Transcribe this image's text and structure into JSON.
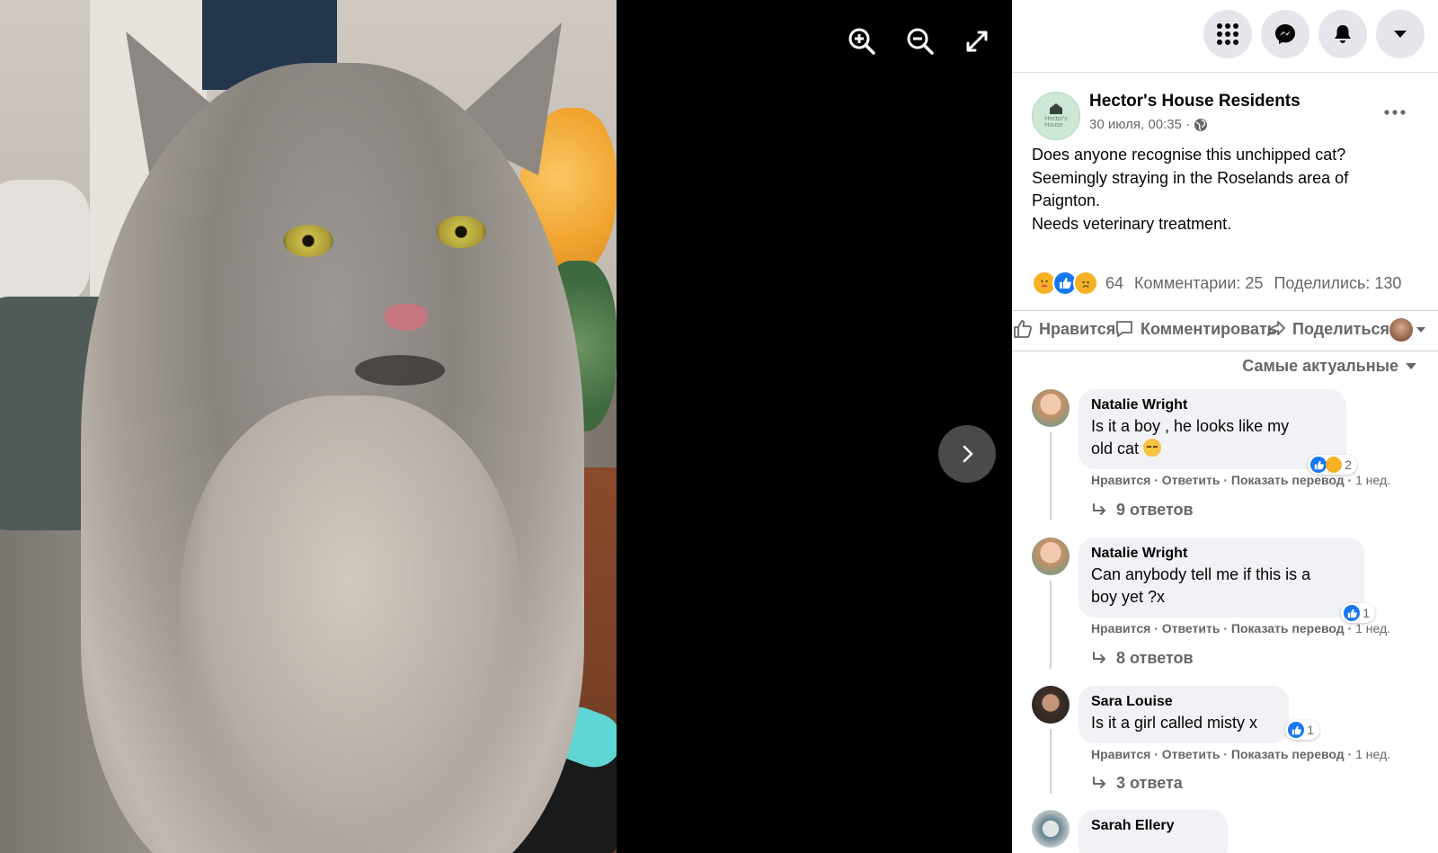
{
  "viewer": {
    "icons": {
      "zoom_in": "zoom-in-icon",
      "zoom_out": "zoom-out-icon",
      "fullscreen": "fullscreen-icon",
      "next": "chevron-right-icon"
    }
  },
  "topbar": {
    "icons": [
      "grid-menu-icon",
      "messenger-icon",
      "bell-icon",
      "caret-down-icon"
    ]
  },
  "post": {
    "author": "Hector's House Residents",
    "date": "30 июля, 00:35 ·",
    "privacy_icon": "globe-icon",
    "text_lines": [
      "Does anyone recognise this unchipped cat?",
      "Seemingly straying in the Roselands area of",
      "Paignton.",
      "Needs veterinary treatment."
    ],
    "reactions": {
      "count": "64",
      "types": [
        "care",
        "like",
        "sad"
      ]
    },
    "comments_count": "Комментарии: 25",
    "shares_count": "Поделились: 130",
    "actions": {
      "like": "Нравится",
      "comment": "Комментировать",
      "share": "Поделиться"
    },
    "sort_label": "Самые актуальные"
  },
  "comments": [
    {
      "author": "Natalie Wright",
      "text_lines": [
        "Is it a boy , he looks like my",
        "old cat"
      ],
      "emoji": "pensive-face",
      "reaction_count": "2",
      "like": "Нравится",
      "reply": "Ответить",
      "translate": "Показать перевод",
      "time": "1 нед.",
      "replies": "9 ответов"
    },
    {
      "author": "Natalie Wright",
      "text_lines": [
        "Can anybody tell me if this is a",
        "boy yet ?x"
      ],
      "reaction_count": "1",
      "like": "Нравится",
      "reply": "Ответить",
      "translate": "Показать перевод",
      "time": "1 нед.",
      "replies": "8 ответов"
    },
    {
      "author": "Sara Louise",
      "text_lines": [
        "Is it a girl called misty x"
      ],
      "reaction_count": "1",
      "like": "Нравится",
      "reply": "Ответить",
      "translate": "Показать перевод",
      "time": "1 нед.",
      "replies": "3 ответа"
    },
    {
      "author": "Sarah Ellery"
    }
  ],
  "colors": {
    "accent": "#1877f2",
    "secondary_text": "#65676b",
    "bubble": "#f0f2f5",
    "divider": "#ced0d4"
  }
}
